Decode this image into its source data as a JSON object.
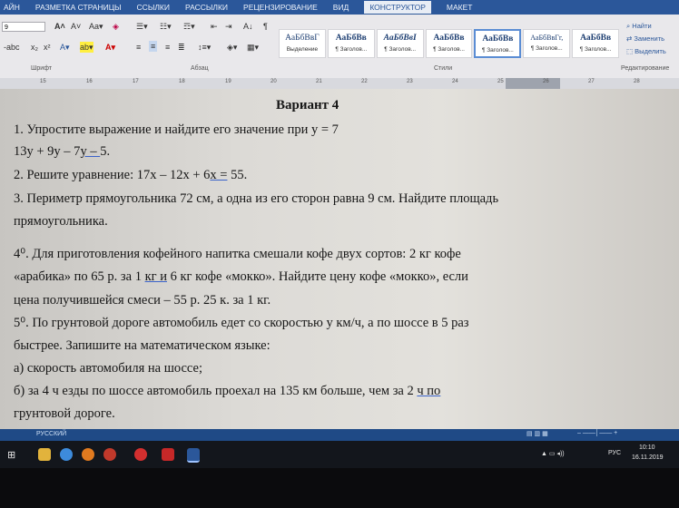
{
  "ribbon_tabs": [
    "АЙН",
    "РАЗМЕТКА СТРАНИЦЫ",
    "ССЫЛКИ",
    "РАССЫЛКИ",
    "РЕЦЕНЗИРОВАНИЕ",
    "ВИД",
    "КОНСТРУКТОР",
    "МАКЕТ"
  ],
  "font": {
    "size": "9"
  },
  "groups": {
    "font": "Шрифт",
    "paragraph": "Абзац",
    "styles": "Стили",
    "editing": "Редактирование"
  },
  "styles": [
    {
      "preview": "АаБбВвГ",
      "name": "Выделение"
    },
    {
      "preview": "АаБбВв",
      "name": "¶ Заголов..."
    },
    {
      "preview": "АаБбВвІ",
      "name": "¶ Заголов..."
    },
    {
      "preview": "АаБбВв",
      "name": "¶ Заголов..."
    },
    {
      "preview": "АаБбВв",
      "name": "¶ Заголов..."
    },
    {
      "preview": "АаБбВвГг,",
      "name": "¶ Заголов..."
    },
    {
      "preview": "АаБбВв",
      "name": "¶ Заголов..."
    }
  ],
  "editing": {
    "find": "Найти",
    "replace": "Заменить",
    "select": "Выделить"
  },
  "ruler": [
    "15",
    "16",
    "17",
    "18",
    "19",
    "20",
    "21",
    "22",
    "23",
    "24",
    "25",
    "26",
    "27",
    "28"
  ],
  "doc": {
    "title": "Вариант 4",
    "l1": "1. Упростите выражение и найдите его значение при y = 7",
    "l2a": "13y + 9y – 7",
    "l2b": "y – ",
    "l2c": "5.",
    "l3a": "2. Решите уравнение: 17x – 12x + 6",
    "l3b": "x =",
    "l3c": " 55.",
    "l4": "3. Периметр прямоугольника 72 см, а одна из его сторон равна 9 см. Найдите площадь",
    "l5": "прямоугольника.",
    "l6": "4⁰.  Для приготовления кофейного напитка смешали кофе двух сортов: 2 кг кофе",
    "l7a": "«арабика» по 65 р. за 1 ",
    "l7b": "кг  и",
    "l7c": " 6 кг кофе «мокко». Найдите цену кофе «мокко», если",
    "l8": "цена получившейся смеси – 55 р. 25 к. за 1 кг.",
    "l9": "5⁰. По грунтовой дороге автомобиль едет со скоростью y км/ч, а по шоссе в       5 раз",
    "l10": "быстрее. Запишите на математическом языке:",
    "l11": "а) скорость автомобиля на шоссе;",
    "l12a": "б)  за  4  ч  езды  по  шоссе  автомобиль  проехал  на  135  км  больше,  чем  за  2  ",
    "l12b": "ч    по",
    "l13": "грунтовой дороге."
  },
  "status": {
    "language": "РУССКИЙ"
  },
  "tray": {
    "lang": "РУС",
    "time": "10:10",
    "date": "16.11.2019"
  }
}
